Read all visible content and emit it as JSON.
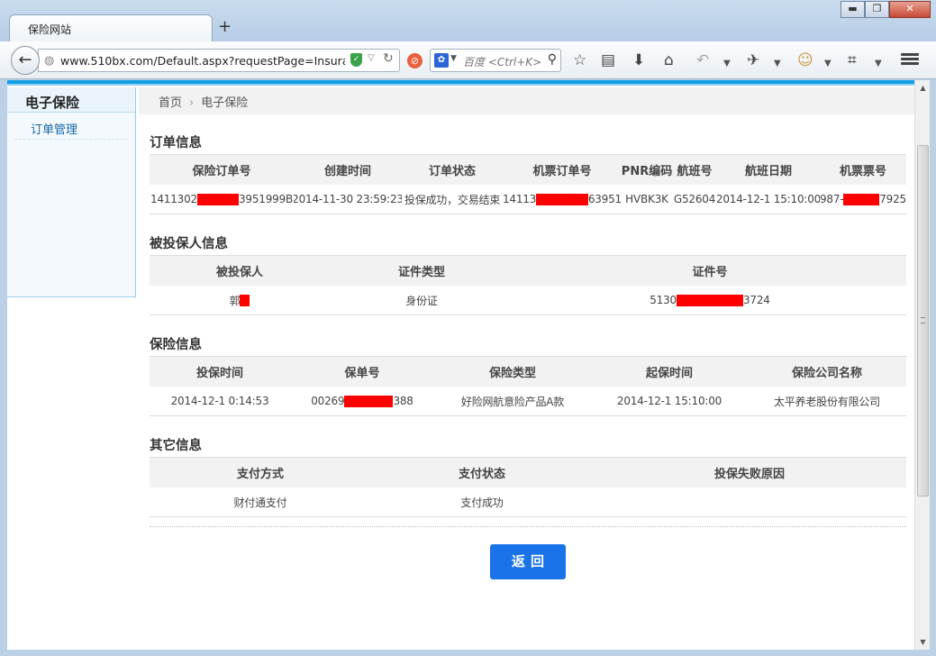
{
  "browser": {
    "tab_title": "保险网站",
    "new_tab": "+",
    "url": "www.510bx.com/Default.aspx?requestPage=Insurance/",
    "search_placeholder": "百度 <Ctrl+K>",
    "window_buttons": {
      "minimize": "▬",
      "maximize": "❐",
      "close": "✕"
    },
    "icons": [
      "back-arrow-icon",
      "globe-icon",
      "shield-icon",
      "dropdown-icon",
      "reload-icon",
      "adblock-icon",
      "baidu-icon",
      "search-icon",
      "star-icon",
      "reading-list-icon",
      "download-icon",
      "home-icon",
      "undo-icon",
      "plugin-icon",
      "face-icon",
      "crop-icon",
      "hamburger-menu-icon"
    ]
  },
  "sidebar": {
    "title": "电子保险",
    "items": [
      {
        "label": "订单管理"
      }
    ]
  },
  "breadcrumb": {
    "home": "首页",
    "separator": "›",
    "current": "电子保险"
  },
  "order_info": {
    "title": "订单信息",
    "columns": [
      "保险订单号",
      "创建时间",
      "订单状态",
      "机票订单号",
      "PNR编码",
      "航班号",
      "航班日期",
      "机票票号"
    ],
    "row": {
      "insurance_order_no_prefix": "1411302",
      "insurance_order_no_suffix": "3951999B",
      "created_at": "2014-11-30 23:59:23",
      "status": "投保成功，交易结束",
      "ticket_order_no_prefix": "14113",
      "ticket_order_no_suffix": "63951",
      "pnr": "HVBK3K",
      "flight_no": "G52604",
      "flight_date": "2014-12-1 15:10:00",
      "ticket_no_prefix": "987-",
      "ticket_no_suffix": "7925"
    }
  },
  "insured_info": {
    "title": "被投保人信息",
    "columns": [
      "被投保人",
      "证件类型",
      "证件号"
    ],
    "row": {
      "name_prefix": "郭",
      "id_type": "身份证",
      "id_no_prefix": "5130",
      "id_no_suffix": "3724"
    }
  },
  "insurance_info": {
    "title": "保险信息",
    "columns": [
      "投保时间",
      "保单号",
      "保险类型",
      "起保时间",
      "保险公司名称"
    ],
    "row": {
      "insured_at": "2014-12-1 0:14:53",
      "policy_no_prefix": "00269",
      "policy_no_suffix": "388",
      "type": "好险网航意险产品A款",
      "start_at": "2014-12-1 15:10:00",
      "company": "太平养老股份有限公司"
    }
  },
  "other_info": {
    "title": "其它信息",
    "columns": [
      "支付方式",
      "支付状态",
      "投保失败原因"
    ],
    "row": {
      "pay_method": "财付通支付",
      "pay_status": "支付成功",
      "fail_reason": ""
    }
  },
  "actions": {
    "back_label": "返回"
  },
  "colors": {
    "accent": "#1a73e8",
    "stripe": "#12a0e4",
    "redaction": "#ff0000"
  }
}
